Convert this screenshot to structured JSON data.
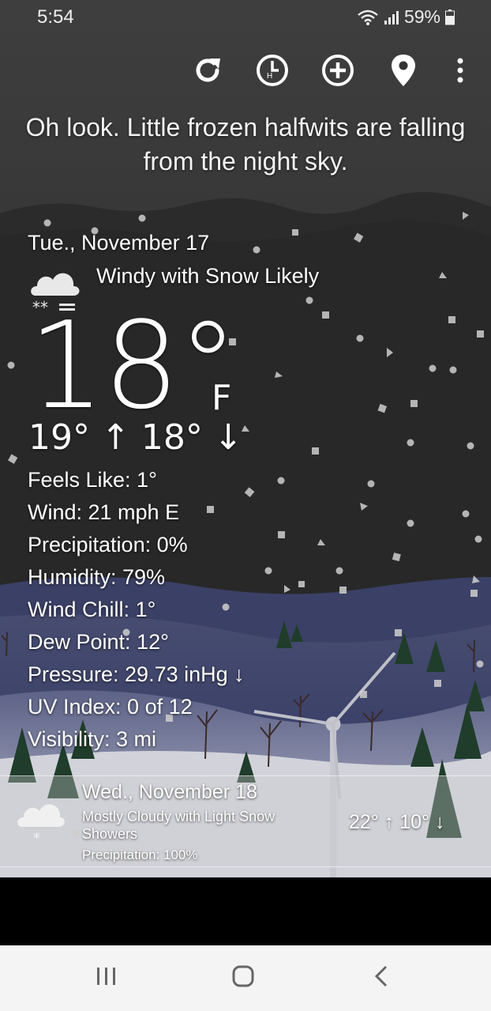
{
  "status_bar": {
    "time": "5:54",
    "battery": "59%"
  },
  "toolbar": {
    "icons": [
      "refresh-icon",
      "history-clock-icon",
      "add-location-icon",
      "location-pin-icon",
      "more-vert-icon"
    ]
  },
  "quip": "Oh look. Little frozen halfwits are falling from the night sky.",
  "today": {
    "date": "Tue., November 17",
    "condition": "Windy with Snow Likely",
    "temperature": "18°",
    "unit": "F",
    "hi_lo": "19° ↑ 18° ↓",
    "details": [
      "Feels Like: 1°",
      "Wind: 21 mph E",
      "Precipitation: 0%",
      "Humidity: 79%",
      "Wind Chill: 1°",
      "Dew Point: 12°",
      "Pressure: 29.73 inHg ↓",
      "UV Index: 0 of 12",
      "Visibility: 3 mi"
    ]
  },
  "forecast": [
    {
      "date": "Wed., November 18",
      "condition": "Mostly Cloudy with Light Snow Showers",
      "precipitation": "Precipitation: 100%",
      "hi_lo": "22° ↑  10° ↓"
    }
  ],
  "nav": {
    "icons": [
      "recent-apps-icon",
      "home-icon",
      "back-icon"
    ]
  },
  "colors": {
    "sky_top": "#3d3d3d",
    "sky_band": "#2b2b2b",
    "hills": "#3d4370",
    "snow_ground": "#dcdce2",
    "tree": "#1e3a2a",
    "nav_bg": "#f4f4f4"
  }
}
